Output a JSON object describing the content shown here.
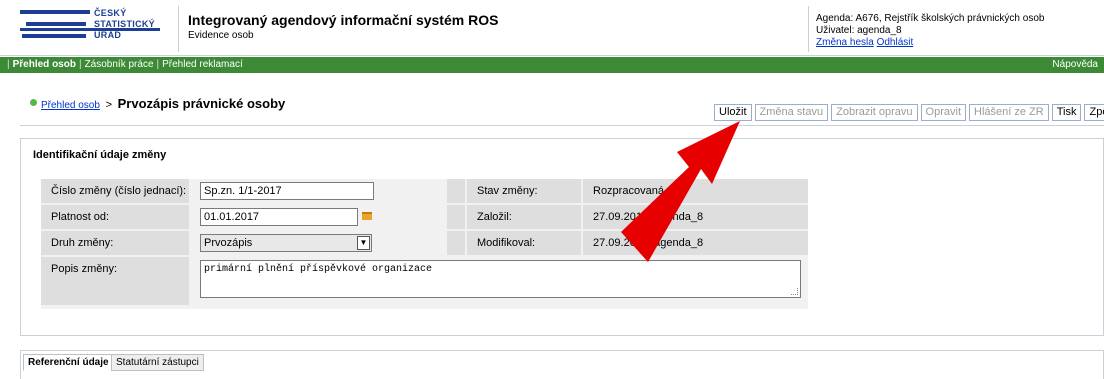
{
  "header": {
    "logo_lines": [
      "ČESKÝ",
      "STATISTICKÝ",
      "ÚŘAD"
    ],
    "title": "Integrovaný agendový informační systém ROS",
    "subtitle": "Evidence osob",
    "agenda": "Agenda: A676, Rejstřík školských právnických osob",
    "user": "Uživatel: agenda_8",
    "change_password": "Změna hesla",
    "logout": "Odhlásit"
  },
  "menubar": {
    "items": [
      "Přehled osob",
      "Zásobník práce",
      "Přehled reklamací"
    ],
    "help": "Nápověda"
  },
  "breadcrumb": {
    "link": "Přehled osob",
    "separator": ">",
    "title": "Prvozápis právnické osoby"
  },
  "toolbar": {
    "buttons": [
      {
        "label": "Uložit",
        "enabled": true
      },
      {
        "label": "Změna stavu",
        "enabled": false
      },
      {
        "label": "Zobrazit opravu",
        "enabled": false
      },
      {
        "label": "Opravit",
        "enabled": false
      },
      {
        "label": "Hlášení ze ZR",
        "enabled": false
      },
      {
        "label": "Tisk",
        "enabled": true
      },
      {
        "label": "Zpět",
        "enabled": true
      }
    ]
  },
  "form": {
    "section_title": "Identifikační údaje změny",
    "cislo_zmeny_label": "Číslo změny (číslo jednací):",
    "cislo_zmeny_value": "Sp.zn. 1/1-2017",
    "platnost_label": "Platnost od:",
    "platnost_value": "01.01.2017",
    "druh_label": "Druh změny:",
    "druh_value": "Prvozápis",
    "popis_label": "Popis změny:",
    "popis_value": "primární plnění příspěvkové organizace",
    "stav_label": "Stav změny:",
    "stav_value": "Rozpracovaná",
    "zalozil_label": "Založil:",
    "zalozil_value": "27.09.2016, agenda_8",
    "modifikoval_label": "Modifikoval:",
    "modifikoval_value": "27.09.2016, agenda_8"
  },
  "tabs": [
    "Referenční údaje",
    "Statutární zástupci"
  ],
  "colors": {
    "brand_blue": "#1c3f94",
    "menubar_green": "#3d8a36",
    "arrow_red": "#e60000"
  }
}
